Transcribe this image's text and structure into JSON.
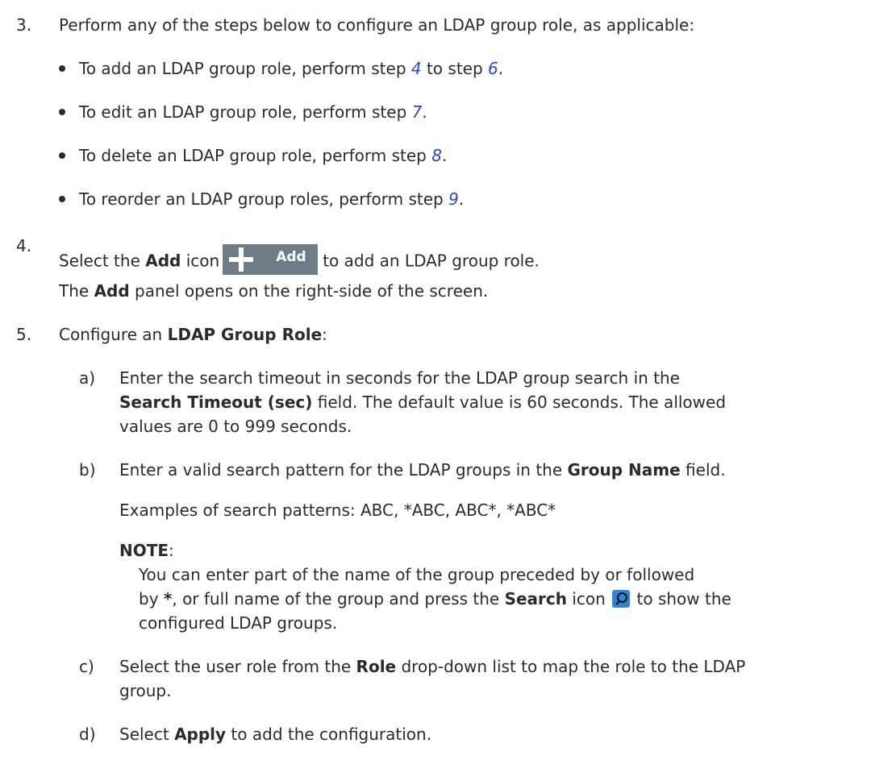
{
  "step3": {
    "number": "3.",
    "text": "Perform any of the steps below to configure an LDAP group role, as applicable:",
    "bullets": [
      {
        "before": "To add an LDAP group role, perform step ",
        "link1": "4",
        "middle": " to step ",
        "link2": "6",
        "after": "."
      },
      {
        "before": "To edit an LDAP group role, perform step ",
        "link1": "7",
        "after": "."
      },
      {
        "before": "To delete an LDAP group role, perform step ",
        "link1": "8",
        "after": "."
      },
      {
        "before": "To reorder an LDAP group roles, perform step ",
        "link1": "9",
        "after": "."
      }
    ]
  },
  "step4": {
    "number": "4.",
    "line1_before": "Select the ",
    "line1_bold": "Add",
    "line1_mid": " icon",
    "add_button_label": "Add",
    "line1_after": "to add an LDAP group role.",
    "line2_bold": "Add",
    "line2_after": " panel opens on the right-side of the screen.",
    "line2_the": "The "
  },
  "step5": {
    "number": "5.",
    "text": "Configure an ",
    "bold": "LDAP Group Role",
    "colon": ":",
    "a": {
      "letter": "a)",
      "line1": "Enter the search timeout in seconds for the LDAP group search in the",
      "bold": "Search Timeout (sec)",
      "line2_after": " field. The default value is 60 seconds. The allowed",
      "line3": "values are 0 to 999 seconds."
    },
    "b": {
      "letter": "b)",
      "before": "Enter a valid search pattern for the LDAP groups in the ",
      "bold": "Group Name",
      "after": " field.",
      "examples": "Examples of search patterns: ABC, *ABC, ABC*, *ABC*",
      "note_label": "NOTE",
      "note_colon": ":",
      "note_line1": "You can enter part of the name of the group preceded by or followed",
      "note_line2_a": "by ",
      "note_line2_star": "*",
      "note_line2_b": ", or full name of the group and press the ",
      "note_line2_bold": "Search",
      "note_line2_c": " icon",
      "note_line2_d": " to show the",
      "note_line3": "configured LDAP groups."
    },
    "c": {
      "letter": "c)",
      "before": "Select the user role from the ",
      "bold": "Role",
      "after": " drop-down list to map the role to the LDAP",
      "line2": "group."
    },
    "d": {
      "letter": "d)",
      "before": "Select ",
      "bold": "Apply",
      "after": " to add the configuration."
    }
  }
}
